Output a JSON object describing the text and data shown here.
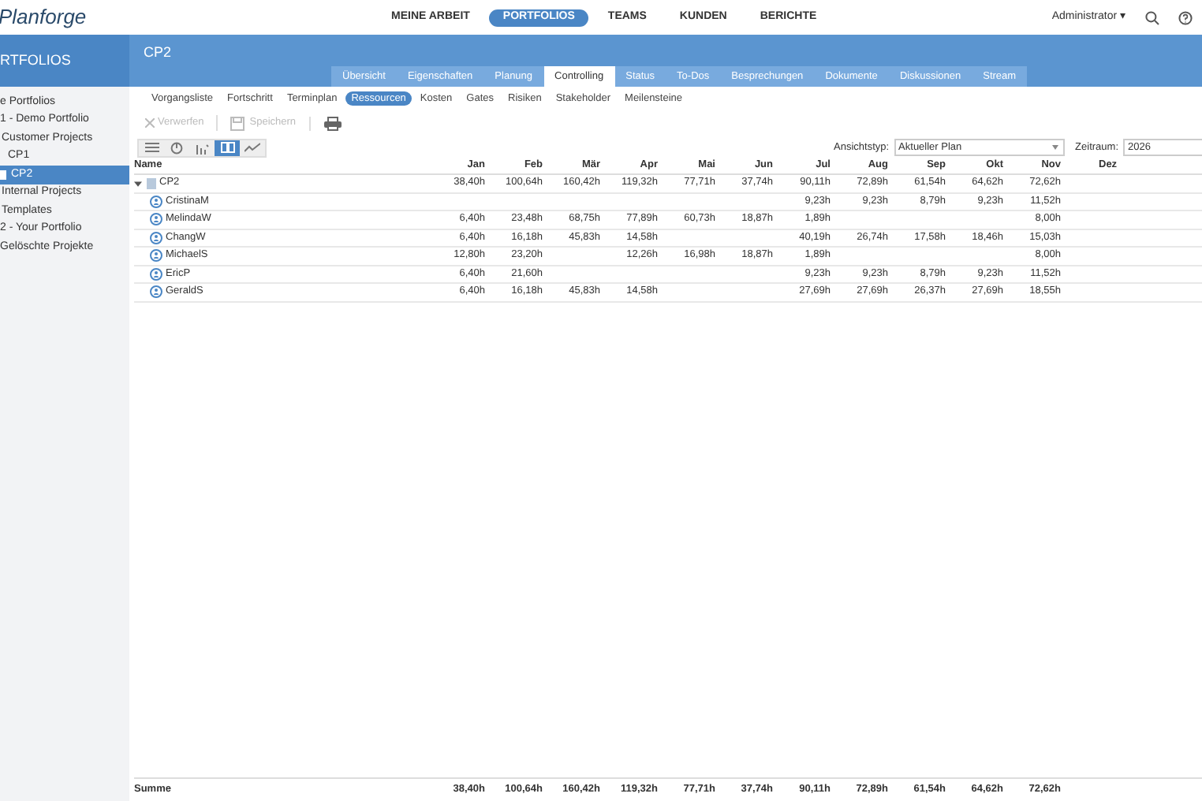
{
  "logo": {
    "text": "Planforge"
  },
  "nav": [
    {
      "label": "MEINE ARBEIT",
      "selected": false
    },
    {
      "label": "PORTFOLIOS",
      "selected": true
    },
    {
      "label": "TEAMS",
      "selected": false
    },
    {
      "label": "KUNDEN",
      "selected": false
    },
    {
      "label": "BERICHTE",
      "selected": false
    }
  ],
  "user_menu": {
    "label": "Administrator",
    "caret": "▾"
  },
  "sidebar": {
    "title": "RTFOLIOS",
    "items": [
      {
        "label": "e Portfolios",
        "selected": false,
        "children": [
          {
            "label": "1 - Demo Portfolio",
            "selected": false,
            "children": [
              {
                "label": "Customer Projects",
                "selected": false,
                "children": [
                  {
                    "label": "CP1",
                    "selected": false
                  },
                  {
                    "label": "CP2",
                    "selected": true
                  }
                ]
              },
              {
                "label": "Internal Projects",
                "selected": false
              },
              {
                "label": "Templates",
                "selected": false
              }
            ]
          },
          {
            "label": "2 - Your Portfolio",
            "selected": false
          }
        ]
      },
      {
        "label": "Gelöschte Projekte",
        "selected": false
      }
    ]
  },
  "project": {
    "title": "CP2"
  },
  "tabs": [
    {
      "label": "Übersicht",
      "selected": false
    },
    {
      "label": "Eigenschaften",
      "selected": false
    },
    {
      "label": "Planung",
      "selected": false
    },
    {
      "label": "Controlling",
      "selected": true
    },
    {
      "label": "Status",
      "selected": false
    },
    {
      "label": "To-Dos",
      "selected": false
    },
    {
      "label": "Besprechungen",
      "selected": false
    },
    {
      "label": "Dokumente",
      "selected": false
    },
    {
      "label": "Diskussionen",
      "selected": false
    },
    {
      "label": "Stream",
      "selected": false
    }
  ],
  "subtabs": [
    {
      "label": "Vorgangsliste",
      "selected": false
    },
    {
      "label": "Fortschritt",
      "selected": false
    },
    {
      "label": "Terminplan",
      "selected": false
    },
    {
      "label": "Ressourcen",
      "selected": true
    },
    {
      "label": "Kosten",
      "selected": false
    },
    {
      "label": "Gates",
      "selected": false
    },
    {
      "label": "Risiken",
      "selected": false
    },
    {
      "label": "Stakeholder",
      "selected": false
    },
    {
      "label": "Meilensteine",
      "selected": false
    }
  ],
  "toolbar": [
    {
      "kind": "discard",
      "label": "Verwerfen",
      "disabled": true
    },
    {
      "kind": "save",
      "label": "Speichern",
      "disabled": true
    },
    {
      "kind": "print",
      "disabled": false
    }
  ],
  "views": [
    {
      "kind": "list",
      "selected": false
    },
    {
      "kind": "pie",
      "selected": false
    },
    {
      "kind": "bars",
      "selected": false
    },
    {
      "kind": "grid",
      "selected": true
    },
    {
      "kind": "line",
      "selected": false
    }
  ],
  "view_type": {
    "label": "Ansichtstyp:",
    "value": "Aktueller Plan"
  },
  "period": {
    "label": "Zeitraum:",
    "value": "2026"
  },
  "table": {
    "columns": [
      "Name",
      "Jan",
      "Feb",
      "Mär",
      "Apr",
      "Mai",
      "Jun",
      "Jul",
      "Aug",
      "Sep",
      "Okt",
      "Nov",
      "Dez"
    ],
    "rows": [
      {
        "kind": "project",
        "name": "CP2",
        "expanded": true,
        "values": {
          "jan": "38,40h",
          "feb": "100,64h",
          "mar": "160,42h",
          "apr": "119,32h",
          "may": "77,71h",
          "jun": "37,74h",
          "jul": "90,11h",
          "aug": "72,89h",
          "sep": "61,54h",
          "oct": "64,62h",
          "nov": "72,62h"
        }
      },
      {
        "kind": "person",
        "name": "CristinaM",
        "values": {
          "jul": "9,23h",
          "aug": "9,23h",
          "sep": "8,79h",
          "oct": "9,23h",
          "nov": "11,52h"
        }
      },
      {
        "kind": "person",
        "name": "MelindaW",
        "values": {
          "jan": "6,40h",
          "feb": "23,48h",
          "mar": "68,75h",
          "apr": "77,89h",
          "may": "60,73h",
          "jun": "18,87h",
          "jul": "1,89h",
          "nov": "8,00h"
        }
      },
      {
        "kind": "person",
        "name": "ChangW",
        "values": {
          "jan": "6,40h",
          "feb": "16,18h",
          "mar": "45,83h",
          "apr": "14,58h",
          "jul": "40,19h",
          "aug": "26,74h",
          "sep": "17,58h",
          "oct": "18,46h",
          "nov": "15,03h"
        }
      },
      {
        "kind": "person",
        "name": "MichaelS",
        "values": {
          "jan": "12,80h",
          "feb": "23,20h",
          "apr": "12,26h",
          "may": "16,98h",
          "jun": "18,87h",
          "jul": "1,89h",
          "nov": "8,00h"
        }
      },
      {
        "kind": "person",
        "name": "EricP",
        "values": {
          "jan": "6,40h",
          "feb": "21,60h",
          "jul": "9,23h",
          "aug": "9,23h",
          "sep": "8,79h",
          "oct": "9,23h",
          "nov": "11,52h"
        }
      },
      {
        "kind": "person",
        "name": "GeraldS",
        "values": {
          "jan": "6,40h",
          "feb": "16,18h",
          "mar": "45,83h",
          "apr": "14,58h",
          "jul": "27,69h",
          "aug": "27,69h",
          "sep": "26,37h",
          "oct": "27,69h",
          "nov": "18,55h"
        }
      }
    ],
    "total": {
      "name": "Summe",
      "values": {
        "jan": "38,40h",
        "feb": "100,64h",
        "mar": "160,42h",
        "apr": "119,32h",
        "may": "77,71h",
        "jun": "37,74h",
        "jul": "90,11h",
        "aug": "72,89h",
        "sep": "61,54h",
        "oct": "64,62h",
        "nov": "72,62h"
      }
    }
  }
}
